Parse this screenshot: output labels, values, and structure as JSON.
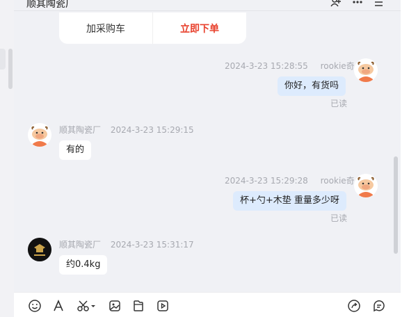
{
  "header": {
    "shop_title": "顺其陶瓷厂"
  },
  "action_card": {
    "add_to_cart": "加采购车",
    "order_now": "立即下单"
  },
  "messages": [
    {
      "side": "mine",
      "sender": "rookie奇",
      "time": "2024-3-23 15:28:55",
      "text": "你好，有货吗",
      "status": "已读",
      "avatar": "cow-avatar"
    },
    {
      "side": "theirs",
      "sender": "顺其陶瓷厂",
      "time": "2024-3-23 15:29:15",
      "text": "有的",
      "avatar": "cow-avatar"
    },
    {
      "side": "mine",
      "sender": "rookie奇",
      "time": "2024-3-23 15:29:28",
      "text": "杯+勺+木垫 重量多少呀",
      "status": "已读",
      "avatar": "cow-avatar"
    },
    {
      "side": "theirs",
      "sender": "顺其陶瓷厂",
      "time": "2024-3-23 15:31:17",
      "text": "约0.4kg",
      "avatar": "shop-logo-avatar"
    }
  ],
  "toolbar": {
    "left_tools": [
      "emoji-icon",
      "font-icon",
      "scissors-icon",
      "image-icon",
      "file-icon",
      "video-icon"
    ],
    "right_tools": [
      "share-icon",
      "quick-reply-icon"
    ]
  }
}
